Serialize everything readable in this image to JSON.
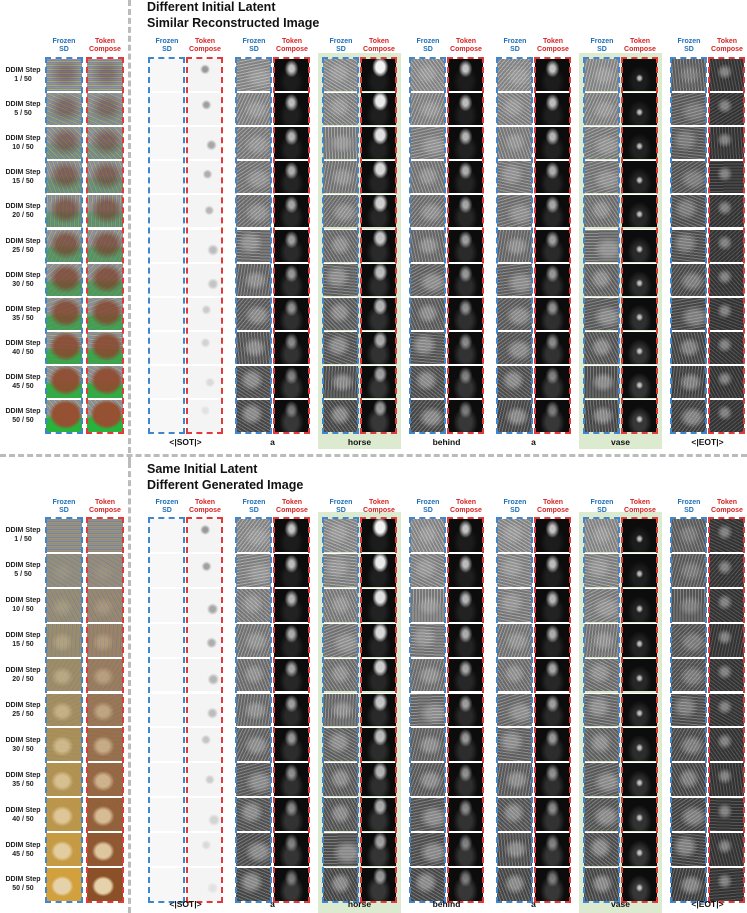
{
  "sections": [
    {
      "title1": "Different Initial Latent",
      "title2": "Similar Reconstructed Image"
    },
    {
      "title1": "Same Initial Latent",
      "title2": "Different Generated Image"
    }
  ],
  "column_headers": {
    "frozen": [
      "Frozen",
      "SD"
    ],
    "token": [
      "Token",
      "Compose"
    ]
  },
  "steps": [
    "1 / 50",
    "5 / 50",
    "10 / 50",
    "15 / 50",
    "20 / 50",
    "25 / 50",
    "30 / 50",
    "35 / 50",
    "40 / 50",
    "45 / 50",
    "50 / 50"
  ],
  "step_prefix": "DDIM Step",
  "tokens": [
    "<|SOT|>",
    "a",
    "horse",
    "behind",
    "a",
    "vase",
    "<|EOT|>"
  ],
  "highlighted_tokens": [
    "horse",
    "vase"
  ],
  "colors": {
    "frozen": "#3f86cf",
    "token_compose": "#e03a3a",
    "highlight": "#dcebd0",
    "divider": "#bbbbbb"
  }
}
